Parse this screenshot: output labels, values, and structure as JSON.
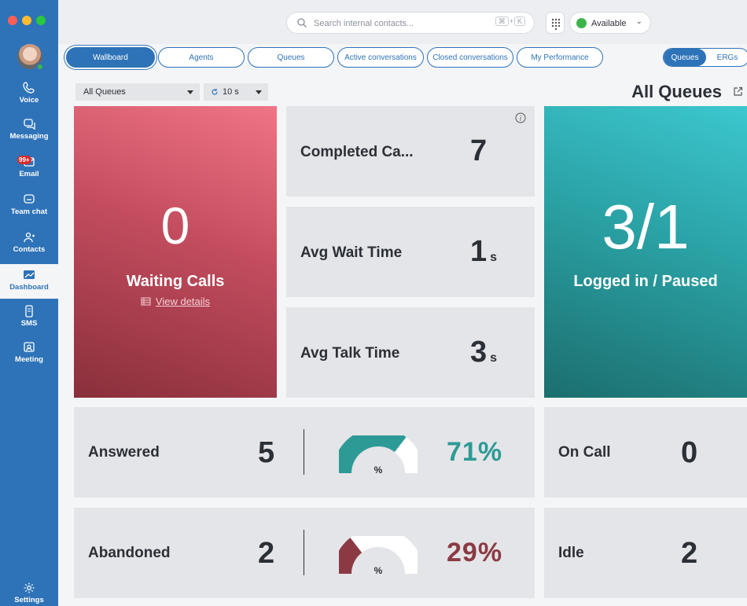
{
  "sidebar": {
    "items": [
      {
        "label": "Voice",
        "icon": "phone-icon"
      },
      {
        "label": "Messaging",
        "icon": "chat-bubbles-icon"
      },
      {
        "label": "Email",
        "icon": "envelope-icon",
        "badge": "99+"
      },
      {
        "label": "Team chat",
        "icon": "team-chat-icon"
      },
      {
        "label": "Contacts",
        "icon": "contacts-icon"
      },
      {
        "label": "Dashboard",
        "icon": "dashboard-icon",
        "active": true
      },
      {
        "label": "SMS",
        "icon": "sms-icon"
      },
      {
        "label": "Meeting",
        "icon": "meeting-icon"
      }
    ],
    "settings_label": "Settings"
  },
  "topbar": {
    "search_placeholder": "Search internal contacts...",
    "shortcut": [
      "⌘",
      "+",
      "K"
    ],
    "status_label": "Available",
    "status_color": "#3bb54a"
  },
  "tabs": [
    "Wallboard",
    "Agents",
    "Queues",
    "Active conversations",
    "Closed conversations",
    "My Performance"
  ],
  "active_tab": "Wallboard",
  "toggle": {
    "left": "Queues",
    "right": "ERGs",
    "selected": "Queues"
  },
  "filters": {
    "queue": "All Queues",
    "refresh": "10 s"
  },
  "heading": "All Queues",
  "waiting": {
    "value": "0",
    "label": "Waiting Calls",
    "link": "View details"
  },
  "completed": {
    "label": "Completed Ca...",
    "value": "7"
  },
  "avg_wait": {
    "label": "Avg Wait Time",
    "value": "1",
    "unit": "s"
  },
  "avg_talk": {
    "label": "Avg Talk Time",
    "value": "3",
    "unit": "s"
  },
  "logged": {
    "value": "3/1",
    "label": "Logged in / Paused"
  },
  "answered": {
    "label": "Answered",
    "value": "5",
    "percent": "71%",
    "fraction": 0.71,
    "color": "#2e9a96",
    "gauge_symbol": "%"
  },
  "abandoned": {
    "label": "Abandoned",
    "value": "2",
    "percent": "29%",
    "fraction": 0.29,
    "color": "#8b3a44",
    "gauge_symbol": "%"
  },
  "on_call": {
    "label": "On Call",
    "value": "0"
  },
  "idle": {
    "label": "Idle",
    "value": "2"
  },
  "colors": {
    "accent": "#2e73b8",
    "red_tile": "#c24c5e",
    "teal_tile": "#2aa1a4"
  }
}
